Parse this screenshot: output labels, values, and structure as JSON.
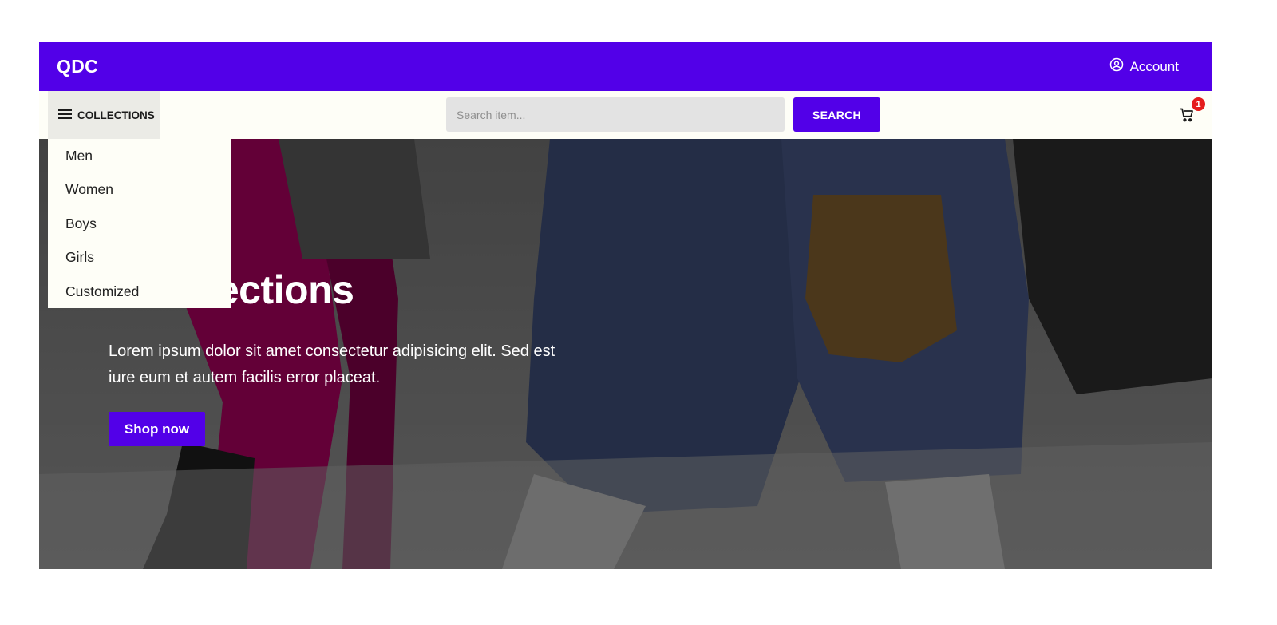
{
  "header": {
    "logo": "QDC",
    "account_label": "Account",
    "account_icon": "user-circle-icon"
  },
  "nav": {
    "collections_label": "COLLECTIONS",
    "collections_icon": "menu-icon",
    "search_placeholder": "Search item...",
    "search_value": "",
    "search_button": "SEARCH",
    "cart_icon": "cart-icon",
    "cart_count": "1"
  },
  "dropdown": {
    "items": [
      {
        "label": "Men"
      },
      {
        "label": "Women"
      },
      {
        "label": "Boys"
      },
      {
        "label": "Girls"
      },
      {
        "label": "Customized"
      }
    ]
  },
  "hero": {
    "title_visible": "n Collections",
    "description": "Lorem ipsum dolor sit amet consectetur adipisicing elit. Sed est iure eum et autem facilis error placeat.",
    "cta_label": "Shop now"
  },
  "colors": {
    "brand": "#5200e8",
    "navbar_bg": "#fefef7",
    "badge": "#e51c1c"
  }
}
